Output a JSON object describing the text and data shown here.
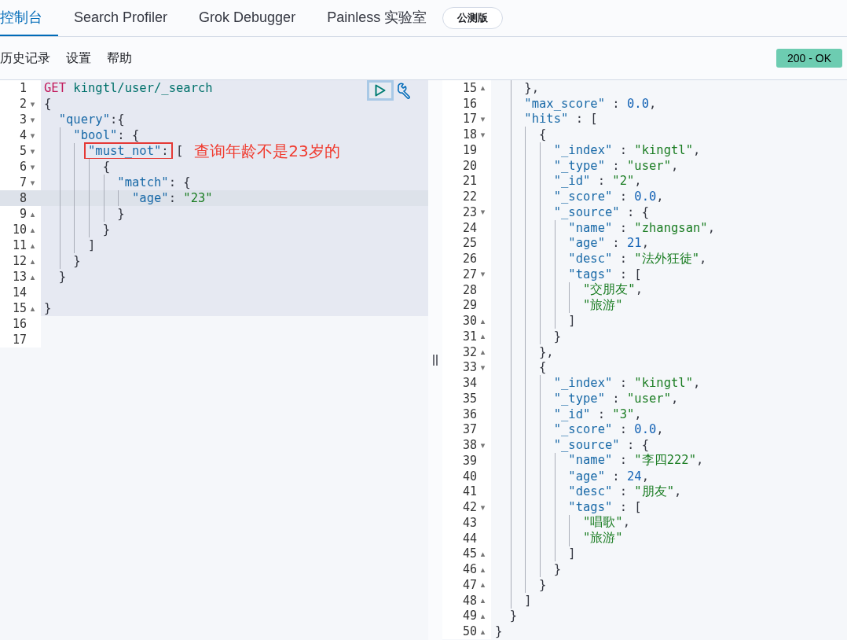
{
  "tabs": [
    {
      "label": "控制台",
      "selected": true
    },
    {
      "label": "Search Profiler",
      "selected": false
    },
    {
      "label": "Grok Debugger",
      "selected": false
    },
    {
      "label": "Painless 实验室",
      "selected": false,
      "badge": "公测版"
    }
  ],
  "toolbar": {
    "items": [
      "历史记录",
      "设置",
      "帮助"
    ],
    "status": "200 - OK"
  },
  "request_editor": {
    "annotation": "查询年龄不是23岁的",
    "request_lines": [
      {
        "n": "1",
        "current": false,
        "tokens": [
          {
            "kind": "method",
            "text": "GET"
          },
          {
            "kind": "url",
            "text": " kingtl/user/_search"
          }
        ]
      },
      {
        "n": "2",
        "fold": "▾",
        "current": false,
        "tokens": [
          {
            "kind": "punct",
            "text": "{"
          }
        ]
      },
      {
        "n": "3",
        "fold": "▾",
        "current": false,
        "tokens": [
          {
            "kind": "key",
            "text": "  \"query\""
          },
          {
            "kind": "punct",
            "text": ":{"
          }
        ]
      },
      {
        "n": "4",
        "fold": "▾",
        "current": false,
        "tokens": [
          {
            "kind": "key",
            "text": "    \"bool\""
          },
          {
            "kind": "punct",
            "text": ": {"
          }
        ]
      },
      {
        "n": "5",
        "fold": "▾",
        "current": false,
        "annotated": true,
        "tokens": [
          {
            "kind": "key",
            "text": "      \"must_not\"",
            "boxed": true
          },
          {
            "kind": "punct",
            "text": ":",
            "boxed": true
          },
          {
            "kind": "punct",
            "text": " ["
          }
        ]
      },
      {
        "n": "6",
        "fold": "▾",
        "current": false,
        "tokens": [
          {
            "kind": "punct",
            "text": "        {"
          }
        ]
      },
      {
        "n": "7",
        "fold": "▾",
        "current": false,
        "tokens": [
          {
            "kind": "key",
            "text": "          \"match\""
          },
          {
            "kind": "punct",
            "text": ": {"
          }
        ]
      },
      {
        "n": "8",
        "current": true,
        "tokens": [
          {
            "kind": "key",
            "text": "            \"age\""
          },
          {
            "kind": "punct",
            "text": ": "
          },
          {
            "kind": "string",
            "text": "\"23\""
          }
        ]
      },
      {
        "n": "9",
        "fold": "▴",
        "current": false,
        "tokens": [
          {
            "kind": "punct",
            "text": "          }"
          }
        ]
      },
      {
        "n": "10",
        "fold": "▴",
        "current": false,
        "tokens": [
          {
            "kind": "punct",
            "text": "        }"
          }
        ]
      },
      {
        "n": "11",
        "fold": "▴",
        "current": false,
        "tokens": [
          {
            "kind": "punct",
            "text": "      ]"
          }
        ]
      },
      {
        "n": "12",
        "fold": "▴",
        "current": false,
        "tokens": [
          {
            "kind": "punct",
            "text": "    }"
          }
        ]
      },
      {
        "n": "13",
        "fold": "▴",
        "current": false,
        "tokens": [
          {
            "kind": "punct",
            "text": "  }"
          }
        ]
      },
      {
        "n": "14",
        "current": false
      },
      {
        "n": "15",
        "fold": "▴",
        "current": false,
        "tokens": [
          {
            "kind": "punct",
            "text": "}"
          }
        ]
      }
    ],
    "trailing_lines": [
      {
        "n": "16",
        "current": false
      },
      {
        "n": "17",
        "current": false
      }
    ]
  },
  "response_editor": {
    "lines": [
      {
        "n": "15",
        "fold": "▴",
        "tokens": [
          {
            "kind": "punct",
            "text": "    },"
          }
        ]
      },
      {
        "n": "16",
        "tokens": [
          {
            "kind": "key",
            "text": "    \"max_score\""
          },
          {
            "kind": "punct",
            "text": " : "
          },
          {
            "kind": "number",
            "text": "0.0"
          },
          {
            "kind": "punct",
            "text": ","
          }
        ]
      },
      {
        "n": "17",
        "fold": "▾",
        "tokens": [
          {
            "kind": "key",
            "text": "    \"hits\""
          },
          {
            "kind": "punct",
            "text": " : ["
          }
        ]
      },
      {
        "n": "18",
        "fold": "▾",
        "tokens": [
          {
            "kind": "punct",
            "text": "      {"
          }
        ]
      },
      {
        "n": "19",
        "tokens": [
          {
            "kind": "key",
            "text": "        \"_index\""
          },
          {
            "kind": "punct",
            "text": " : "
          },
          {
            "kind": "string",
            "text": "\"kingtl\""
          },
          {
            "kind": "punct",
            "text": ","
          }
        ]
      },
      {
        "n": "20",
        "tokens": [
          {
            "kind": "key",
            "text": "        \"_type\""
          },
          {
            "kind": "punct",
            "text": " : "
          },
          {
            "kind": "string",
            "text": "\"user\""
          },
          {
            "kind": "punct",
            "text": ","
          }
        ]
      },
      {
        "n": "21",
        "tokens": [
          {
            "kind": "key",
            "text": "        \"_id\""
          },
          {
            "kind": "punct",
            "text": " : "
          },
          {
            "kind": "string",
            "text": "\"2\""
          },
          {
            "kind": "punct",
            "text": ","
          }
        ]
      },
      {
        "n": "22",
        "tokens": [
          {
            "kind": "key",
            "text": "        \"_score\""
          },
          {
            "kind": "punct",
            "text": " : "
          },
          {
            "kind": "number",
            "text": "0.0"
          },
          {
            "kind": "punct",
            "text": ","
          }
        ]
      },
      {
        "n": "23",
        "fold": "▾",
        "tokens": [
          {
            "kind": "key",
            "text": "        \"_source\""
          },
          {
            "kind": "punct",
            "text": " : {"
          }
        ]
      },
      {
        "n": "24",
        "tokens": [
          {
            "kind": "key",
            "text": "          \"name\""
          },
          {
            "kind": "punct",
            "text": " : "
          },
          {
            "kind": "string",
            "text": "\"zhangsan\""
          },
          {
            "kind": "punct",
            "text": ","
          }
        ]
      },
      {
        "n": "25",
        "tokens": [
          {
            "kind": "key",
            "text": "          \"age\""
          },
          {
            "kind": "punct",
            "text": " : "
          },
          {
            "kind": "number",
            "text": "21"
          },
          {
            "kind": "punct",
            "text": ","
          }
        ]
      },
      {
        "n": "26",
        "tokens": [
          {
            "kind": "key",
            "text": "          \"desc\""
          },
          {
            "kind": "punct",
            "text": " : "
          },
          {
            "kind": "string",
            "text": "\"法外狂徒\""
          },
          {
            "kind": "punct",
            "text": ","
          }
        ]
      },
      {
        "n": "27",
        "fold": "▾",
        "tokens": [
          {
            "kind": "key",
            "text": "          \"tags\""
          },
          {
            "kind": "punct",
            "text": " : ["
          }
        ]
      },
      {
        "n": "28",
        "tokens": [
          {
            "kind": "string",
            "text": "            \"交朋友\""
          },
          {
            "kind": "punct",
            "text": ","
          }
        ]
      },
      {
        "n": "29",
        "tokens": [
          {
            "kind": "string",
            "text": "            \"旅游\""
          }
        ]
      },
      {
        "n": "30",
        "fold": "▴",
        "tokens": [
          {
            "kind": "punct",
            "text": "          ]"
          }
        ]
      },
      {
        "n": "31",
        "fold": "▴",
        "tokens": [
          {
            "kind": "punct",
            "text": "        }"
          }
        ]
      },
      {
        "n": "32",
        "fold": "▴",
        "tokens": [
          {
            "kind": "punct",
            "text": "      },"
          }
        ]
      },
      {
        "n": "33",
        "fold": "▾",
        "tokens": [
          {
            "kind": "punct",
            "text": "      {"
          }
        ]
      },
      {
        "n": "34",
        "tokens": [
          {
            "kind": "key",
            "text": "        \"_index\""
          },
          {
            "kind": "punct",
            "text": " : "
          },
          {
            "kind": "string",
            "text": "\"kingtl\""
          },
          {
            "kind": "punct",
            "text": ","
          }
        ]
      },
      {
        "n": "35",
        "tokens": [
          {
            "kind": "key",
            "text": "        \"_type\""
          },
          {
            "kind": "punct",
            "text": " : "
          },
          {
            "kind": "string",
            "text": "\"user\""
          },
          {
            "kind": "punct",
            "text": ","
          }
        ]
      },
      {
        "n": "36",
        "tokens": [
          {
            "kind": "key",
            "text": "        \"_id\""
          },
          {
            "kind": "punct",
            "text": " : "
          },
          {
            "kind": "string",
            "text": "\"3\""
          },
          {
            "kind": "punct",
            "text": ","
          }
        ]
      },
      {
        "n": "37",
        "tokens": [
          {
            "kind": "key",
            "text": "        \"_score\""
          },
          {
            "kind": "punct",
            "text": " : "
          },
          {
            "kind": "number",
            "text": "0.0"
          },
          {
            "kind": "punct",
            "text": ","
          }
        ]
      },
      {
        "n": "38",
        "fold": "▾",
        "tokens": [
          {
            "kind": "key",
            "text": "        \"_source\""
          },
          {
            "kind": "punct",
            "text": " : {"
          }
        ]
      },
      {
        "n": "39",
        "tokens": [
          {
            "kind": "key",
            "text": "          \"name\""
          },
          {
            "kind": "punct",
            "text": " : "
          },
          {
            "kind": "string",
            "text": "\"李四222\""
          },
          {
            "kind": "punct",
            "text": ","
          }
        ]
      },
      {
        "n": "40",
        "tokens": [
          {
            "kind": "key",
            "text": "          \"age\""
          },
          {
            "kind": "punct",
            "text": " : "
          },
          {
            "kind": "number",
            "text": "24"
          },
          {
            "kind": "punct",
            "text": ","
          }
        ]
      },
      {
        "n": "41",
        "tokens": [
          {
            "kind": "key",
            "text": "          \"desc\""
          },
          {
            "kind": "punct",
            "text": " : "
          },
          {
            "kind": "string",
            "text": "\"朋友\""
          },
          {
            "kind": "punct",
            "text": ","
          }
        ]
      },
      {
        "n": "42",
        "fold": "▾",
        "tokens": [
          {
            "kind": "key",
            "text": "          \"tags\""
          },
          {
            "kind": "punct",
            "text": " : ["
          }
        ]
      },
      {
        "n": "43",
        "tokens": [
          {
            "kind": "string",
            "text": "            \"唱歌\""
          },
          {
            "kind": "punct",
            "text": ","
          }
        ]
      },
      {
        "n": "44",
        "tokens": [
          {
            "kind": "string",
            "text": "            \"旅游\""
          }
        ]
      },
      {
        "n": "45",
        "fold": "▴",
        "tokens": [
          {
            "kind": "punct",
            "text": "          ]"
          }
        ]
      },
      {
        "n": "46",
        "fold": "▴",
        "tokens": [
          {
            "kind": "punct",
            "text": "        }"
          }
        ]
      },
      {
        "n": "47",
        "fold": "▴",
        "tokens": [
          {
            "kind": "punct",
            "text": "      }"
          }
        ]
      },
      {
        "n": "48",
        "fold": "▴",
        "tokens": [
          {
            "kind": "punct",
            "text": "    ]"
          }
        ]
      },
      {
        "n": "49",
        "fold": "▴",
        "tokens": [
          {
            "kind": "punct",
            "text": "  }"
          }
        ]
      },
      {
        "n": "50",
        "fold": "▴",
        "tokens": [
          {
            "kind": "punct",
            "text": "}"
          }
        ]
      }
    ]
  }
}
